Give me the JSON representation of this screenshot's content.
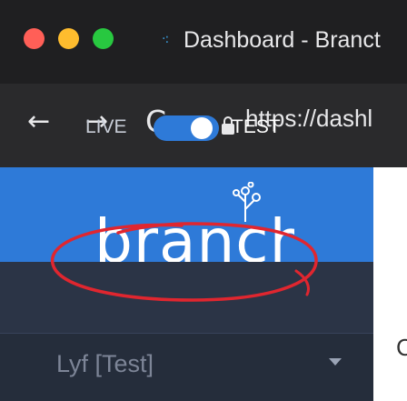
{
  "window": {
    "tab_title": "Dashboard - Branct",
    "tab_icon": "branch-favicon-icon"
  },
  "toolbar": {
    "back_label": "←",
    "forward_label": "→",
    "reload_label": "C",
    "url": "https://dashl"
  },
  "sidebar": {
    "logo_text": "branch",
    "mode_toggle": {
      "live_label": "LIVE",
      "test_label": "TEST",
      "selected": "TEST"
    },
    "app_selector": {
      "value": "Lyf [Test]"
    }
  },
  "right_pane": {
    "partial_text": "C"
  },
  "colors": {
    "accent": "#2e7ad8",
    "sidebar_bg": "#252d3b",
    "annotation": "#e0262f"
  }
}
